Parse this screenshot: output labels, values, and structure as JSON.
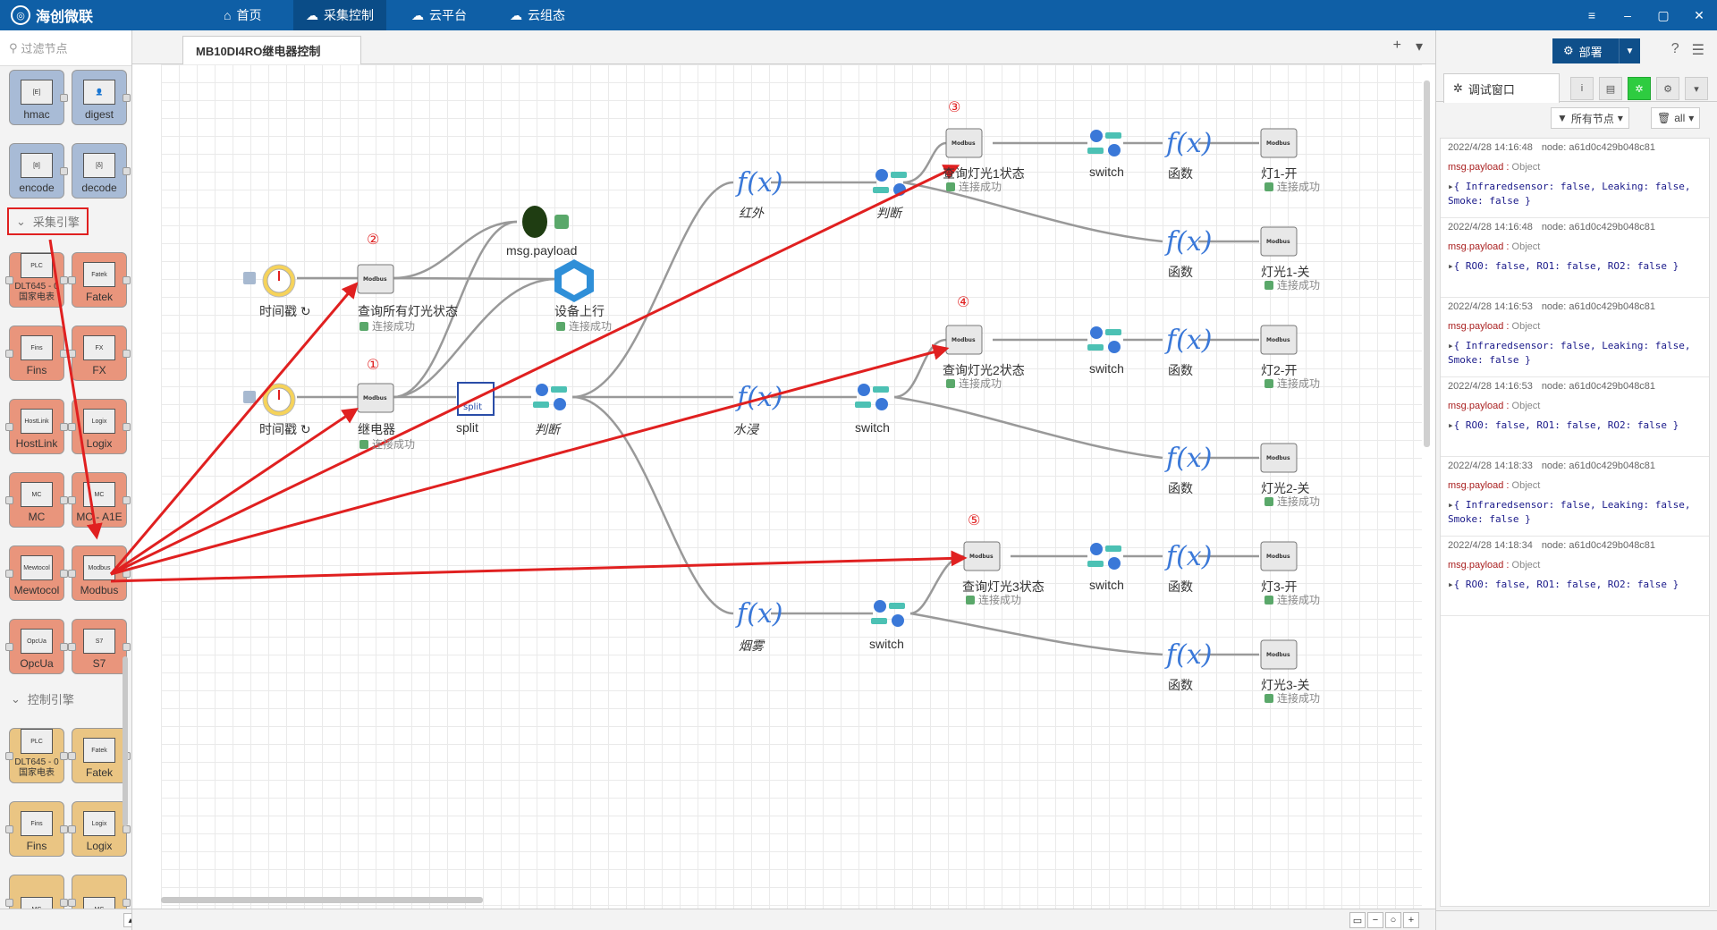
{
  "app": {
    "brand": "海创微联"
  },
  "nav": [
    {
      "label": "首页",
      "icon": "home-icon"
    },
    {
      "label": "采集控制",
      "icon": "cloud-gear-icon"
    },
    {
      "label": "云平台",
      "icon": "cloud-icon"
    },
    {
      "label": "云组态",
      "icon": "cloud-stack-icon"
    }
  ],
  "window_controls": [
    "≡",
    "–",
    "▢",
    "✕"
  ],
  "palette": {
    "filter_placeholder": "过滤节点",
    "categories": {
      "collect": "采集引擎",
      "control": "控制引擎"
    },
    "nodes_top": [
      "hmac",
      "digest",
      "encode",
      "decode"
    ],
    "nodes_collect": [
      "DLT645 - 0 国家电表",
      "Fatek",
      "Fins",
      "FX",
      "HostLink",
      "Logix",
      "MC",
      "MC - A1E",
      "Mewtocol",
      "Modbus",
      "OpcUa",
      "S7"
    ],
    "nodes_control": [
      "DLT645 - 0 国家电表",
      "Fatek",
      "Fins",
      "Logix"
    ]
  },
  "workspace": {
    "tab": "MB10DI4RO继电器控制",
    "add": "+",
    "menu": "▾"
  },
  "flow": {
    "connected": "连接成功",
    "labels": {
      "timestamp1": "时间戳 ↻",
      "timestamp2": "时间戳 ↻",
      "query_all": "查询所有灯光状态",
      "relay": "继电器",
      "debug": "msg.payload",
      "upload": "设备上行",
      "split": "split",
      "judge1": "判断",
      "infrared": "红外",
      "flood": "水浸",
      "smoke": "烟雾",
      "judge2": "判断",
      "switch_flood": "switch",
      "switch_smoke": "switch",
      "q1": "查询灯光1状态",
      "q2": "查询灯光2状态",
      "q3": "查询灯光3状态",
      "sw1": "switch",
      "sw2": "switch",
      "sw3": "switch",
      "fn1a": "函数",
      "fn1b": "函数",
      "fn2a": "函数",
      "fn2b": "函数",
      "fn3a": "函数",
      "fn3b": "函数",
      "l1on": "灯1-开",
      "l1off": "灯光1-关",
      "l2on": "灯2-开",
      "l2off": "灯光2-关",
      "l3on": "灯3-开",
      "l3off": "灯光3-关"
    },
    "annotations": [
      "①",
      "②",
      "③",
      "④",
      "⑤"
    ]
  },
  "sidebar": {
    "deploy": "部署",
    "tab": "调试窗口",
    "filter_nodes": "所有节点",
    "clear": "all",
    "messages": [
      {
        "time": "2022/4/28 14:16:48",
        "node": "node: a61d0c429b048c81",
        "topic": "msg.payload",
        "type": "Object",
        "body": "{ Infraredsensor: false, Leaking: false, Smoke: false }"
      },
      {
        "time": "2022/4/28 14:16:48",
        "node": "node: a61d0c429b048c81",
        "topic": "msg.payload",
        "type": "Object",
        "body": "{ RO0: false, RO1: false, RO2: false }"
      },
      {
        "time": "2022/4/28 14:16:53",
        "node": "node: a61d0c429b048c81",
        "topic": "msg.payload",
        "type": "Object",
        "body": "{ Infraredsensor: false, Leaking: false, Smoke: false }"
      },
      {
        "time": "2022/4/28 14:16:53",
        "node": "node: a61d0c429b048c81",
        "topic": "msg.payload",
        "type": "Object",
        "body": "{ RO0: false, RO1: false, RO2: false }"
      },
      {
        "time": "2022/4/28 14:18:33",
        "node": "node: a61d0c429b048c81",
        "topic": "msg.payload",
        "type": "Object",
        "body": "{ Infraredsensor: false, Leaking: false, Smoke: false }"
      },
      {
        "time": "2022/4/28 14:18:34",
        "node": "node: a61d0c429b048c81",
        "topic": "msg.payload",
        "type": "Object",
        "body": "{ RO0: false, RO1: false, RO2: false }"
      }
    ]
  },
  "colors": {
    "topbar": "#0f5fa6",
    "deploy": "#0f4f8a",
    "annotation": "#e02020",
    "wire": "#999999",
    "status_ok": "#5aa86a"
  }
}
